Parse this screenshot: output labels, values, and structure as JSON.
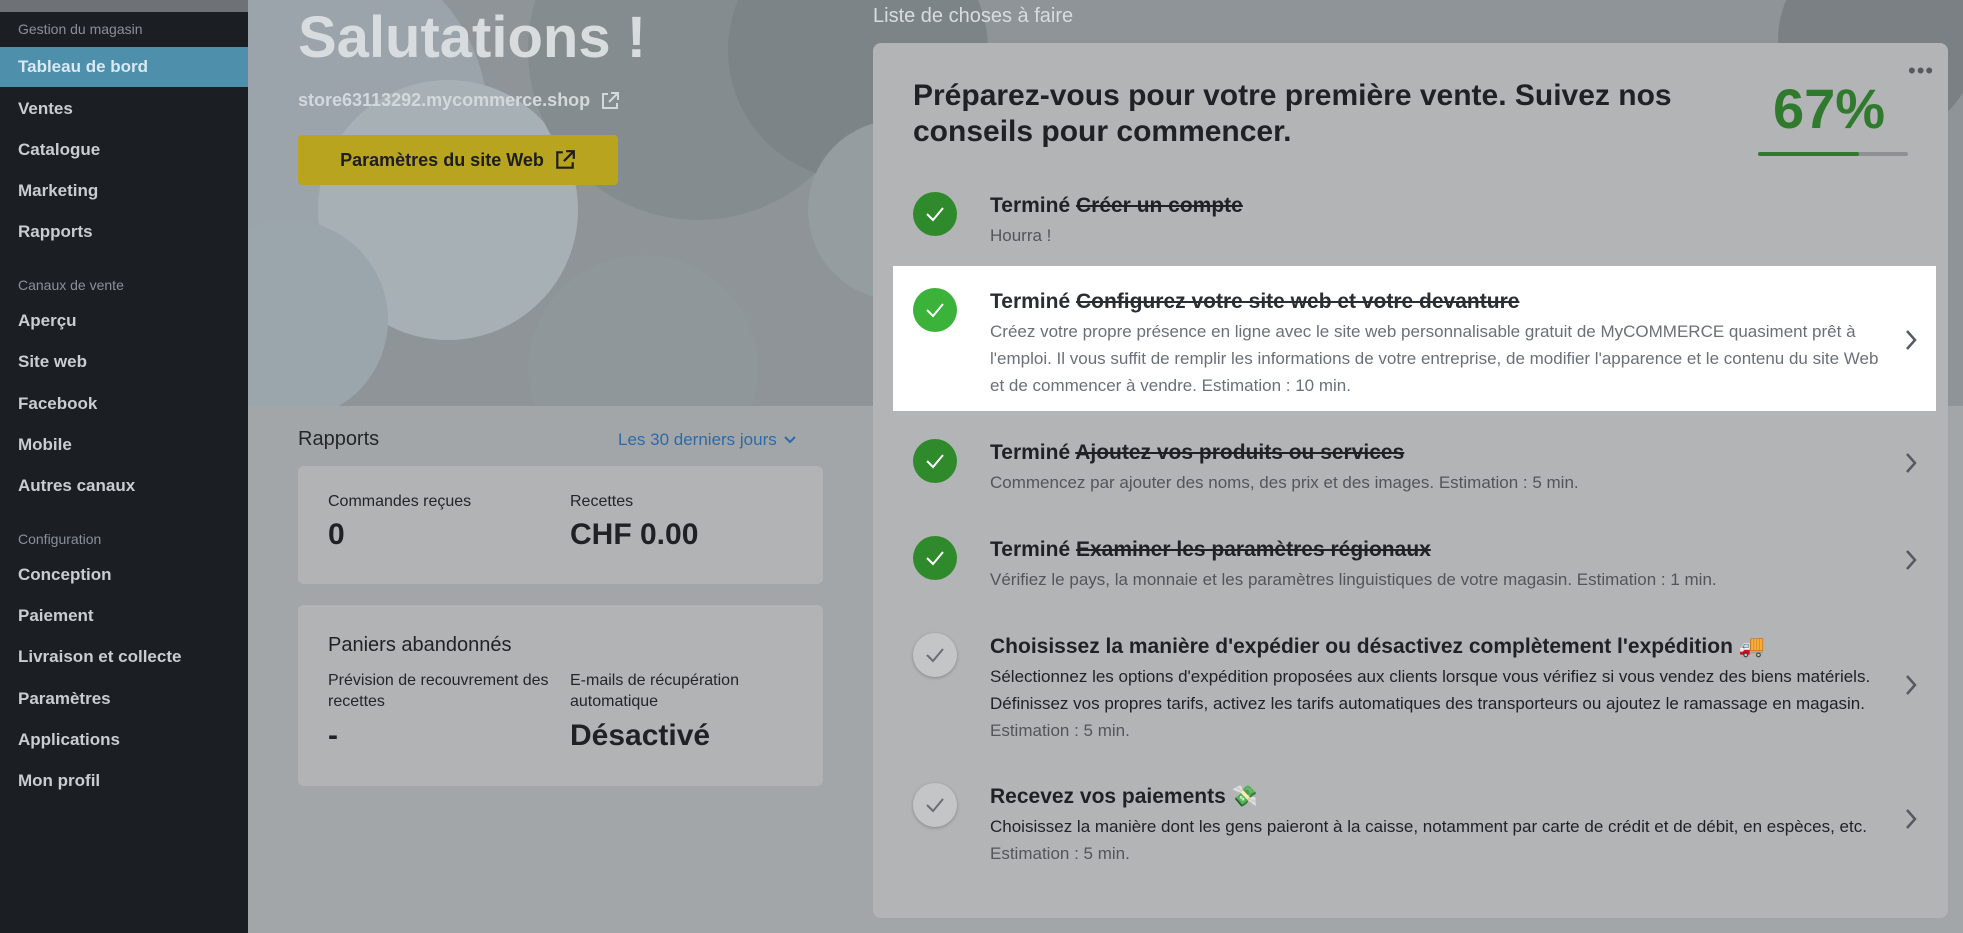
{
  "sidebar": {
    "sections": [
      {
        "label": "Gestion du magasin",
        "items": [
          "Tableau de bord",
          "Ventes",
          "Catalogue",
          "Marketing",
          "Rapports"
        ]
      },
      {
        "label": "Canaux de vente",
        "items": [
          "Aperçu",
          "Site web",
          "Facebook",
          "Mobile",
          "Autres canaux"
        ]
      },
      {
        "label": "Configuration",
        "items": [
          "Conception",
          "Paiement",
          "Livraison et collecte",
          "Paramètres",
          "Applications",
          "Mon profil"
        ]
      }
    ],
    "active_item": "Tableau de bord"
  },
  "hero": {
    "title": "Salutations !",
    "store_url": "store63113292.mycommerce.shop",
    "site_button": "Paramètres du site Web"
  },
  "reports": {
    "title": "Rapports",
    "period": "Les 30 derniers jours",
    "orders_label": "Commandes reçues",
    "orders_value": "0",
    "revenue_label": "Recettes",
    "revenue_value": "CHF 0.00"
  },
  "abandoned": {
    "title": "Paniers abandonnés",
    "forecast_label": "Prévision de recouvrement des recettes",
    "forecast_value": "-",
    "emails_label": "E-mails de récupération automatique",
    "emails_value": "Désactivé"
  },
  "todo": {
    "heading": "Liste de choses à faire",
    "title": "Préparez-vous pour votre première vente. Suivez nos conseils pour commencer.",
    "percent": "67%",
    "progress": 0.67,
    "done_label": "Terminé",
    "tasks": [
      {
        "title": "Créer un compte",
        "desc": "Hourra !",
        "est": ""
      },
      {
        "title": "Configurez votre site web et votre devanture",
        "desc": "Créez votre propre présence en ligne avec le site web personnalisable gratuit de MyCOMMERCE quasiment prêt à l'emploi. Il vous suffit de remplir les informations de votre entreprise, de modifier l'apparence et le contenu du site Web et de commencer à vendre. Estimation : 10 min.",
        "est": ""
      },
      {
        "title": "Ajoutez vos produits ou services",
        "desc": "Commencez par ajouter des noms, des prix et des images. Estimation : 5 min.",
        "est": ""
      },
      {
        "title": "Examiner les paramètres régionaux",
        "desc": "Vérifiez le pays, la monnaie et les paramètres linguistiques de votre magasin. Estimation : 1 min.",
        "est": ""
      },
      {
        "title": "Choisissez la manière d'expédier ou désactivez complètement l'expédition 🚚",
        "desc": "Sélectionnez les options d'expédition proposées aux clients lorsque vous vérifiez si vous vendez des biens matériels. Définissez vos propres tarifs, activez les tarifs automatiques des transporteurs ou ajoutez le ramassage en magasin.",
        "est": "Estimation : 5 min."
      },
      {
        "title": "Recevez vos paiements 💸",
        "desc": "Choisissez la manière dont les gens paieront à la caisse, notamment par carte de crédit et de débit, en espèces, etc.",
        "est": "Estimation : 5 min."
      }
    ]
  },
  "colors": {
    "sidebar_bg": "#1b1f24",
    "active_item": "#4e8fab",
    "accent_button": "#b8a41e",
    "success": "#2f7a2c",
    "link": "#2d6aa7"
  }
}
